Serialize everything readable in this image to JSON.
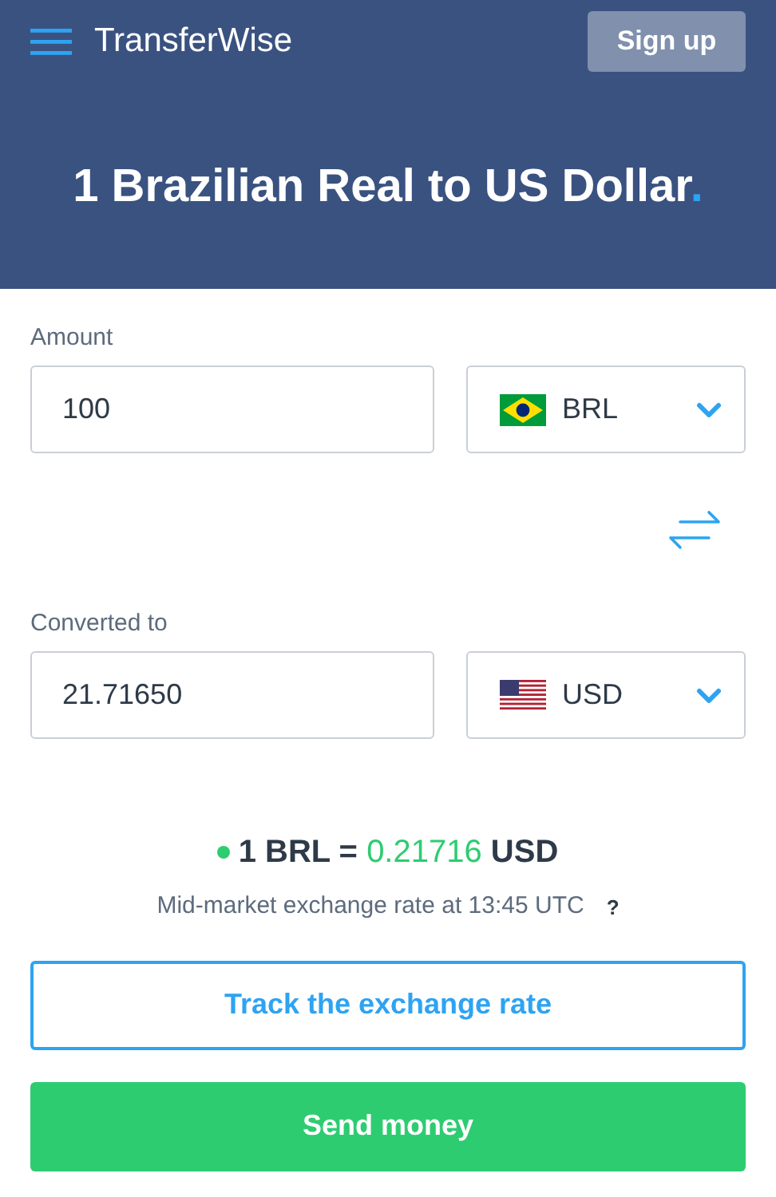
{
  "header": {
    "brand": "TransferWise",
    "signup": "Sign up",
    "title": "1 Brazilian Real to US Dollar",
    "title_dot": "."
  },
  "converter": [
    {
      "label": "Amount",
      "value": "100",
      "currency": "BRL"
    },
    {
      "label": "Converted to",
      "value": "21.71650",
      "currency": "USD"
    }
  ],
  "rate": {
    "prefix": "1 BRL =",
    "value": "0.21716",
    "suffix": "USD",
    "note": "Mid-market exchange rate at 13:45 UTC",
    "help": "?"
  },
  "buttons": {
    "track": "Track the exchange rate",
    "send": "Send money"
  }
}
